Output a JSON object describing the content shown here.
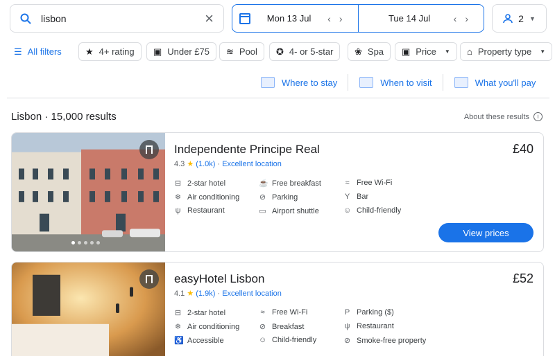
{
  "search": {
    "query": "lisbon"
  },
  "dates": {
    "checkin": "Mon 13 Jul",
    "checkout": "Tue 14 Jul"
  },
  "guests": {
    "count": "2"
  },
  "filters": {
    "all_filters": "All filters",
    "chips": [
      "4+ rating",
      "Under £75",
      "Pool",
      "4- or 5-star",
      "Spa",
      "Price",
      "Property type"
    ]
  },
  "explore_links": [
    "Where to stay",
    "When to visit",
    "What you'll pay"
  ],
  "results": {
    "title": "Lisbon · 15,000 results",
    "about": "About these results"
  },
  "hotels": [
    {
      "name": "Independente Principe Real",
      "price": "£40",
      "rating": "4.3",
      "reviews": "(1.0k)",
      "tag": "Excellent location",
      "amenities": [
        "2-star hotel",
        "Free breakfast",
        "Free Wi-Fi",
        "Air conditioning",
        "Parking",
        "Bar",
        "Restaurant",
        "Airport shuttle",
        "Child-friendly"
      ],
      "cta": "View prices"
    },
    {
      "name": "easyHotel Lisbon",
      "price": "£52",
      "rating": "4.1",
      "reviews": "(1.9k)",
      "tag": "Excellent location",
      "amenities": [
        "2-star hotel",
        "Free Wi-Fi",
        "Parking ($)",
        "Air conditioning",
        "Breakfast",
        "Restaurant",
        "Accessible",
        "Child-friendly",
        "Smoke-free property"
      ]
    }
  ],
  "colors": {
    "accent": "#1a73e8",
    "star": "#fbbc04",
    "border": "#dadce0"
  }
}
